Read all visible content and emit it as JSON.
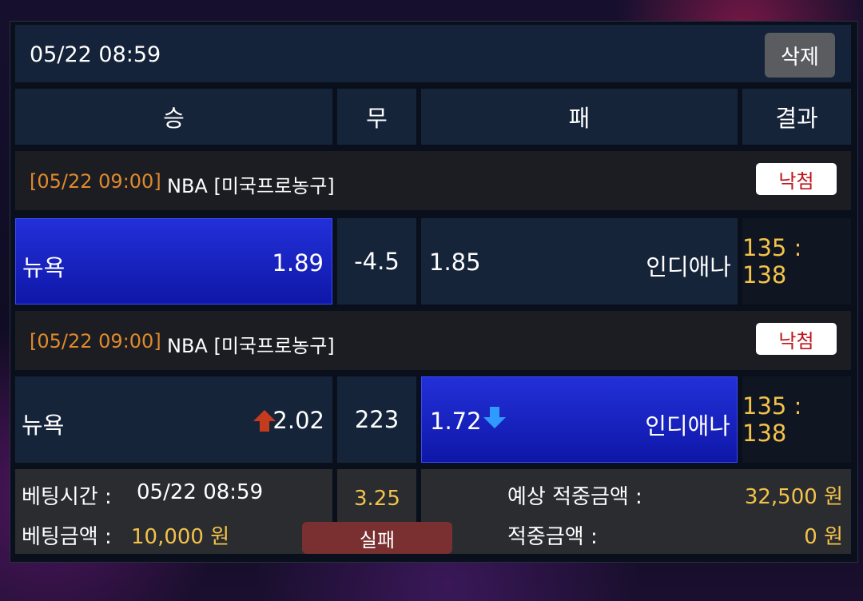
{
  "header": {
    "timestamp": "05/22 08:59",
    "delete_label": "삭제"
  },
  "columns": {
    "win": "승",
    "draw": "무",
    "lose": "패",
    "result": "결과"
  },
  "games": [
    {
      "time_label": "[05/22 09:00]",
      "league": "NBA [미국프로농구]",
      "status": "낙첨",
      "home_team": "뉴욕",
      "home_odds": "1.89",
      "handicap": "-4.5",
      "away_odds": "1.85",
      "away_team": "인디애나",
      "score": "135 : 138",
      "selected": "home"
    },
    {
      "time_label": "[05/22 09:00]",
      "league": "NBA [미국프로농구]",
      "status": "낙첨",
      "home_team": "뉴욕",
      "home_odds": "2.02",
      "home_trend": "up-arrow-icon",
      "handicap": "223",
      "away_odds": "1.72",
      "away_trend": "down-arrow-icon",
      "away_team": "인디애나",
      "score": "135 : 138",
      "selected": "away"
    }
  ],
  "summary": {
    "bet_time_label": "베팅시간 :",
    "bet_time": "05/22 08:59",
    "bet_amount_label": "베팅금액 :",
    "bet_amount": "10,000 원",
    "total_odds": "3.25",
    "result_label": "실패",
    "expected_label": "예상 적중금액 :",
    "expected_amount": "32,500 원",
    "win_label": "적중금액 :",
    "win_amount": "0 원"
  },
  "colors": {
    "accent_gold": "#f2c24a",
    "selected_blue": "#1a24c8",
    "fail_badge": "#7a3030",
    "lose_text": "#c0151a"
  }
}
